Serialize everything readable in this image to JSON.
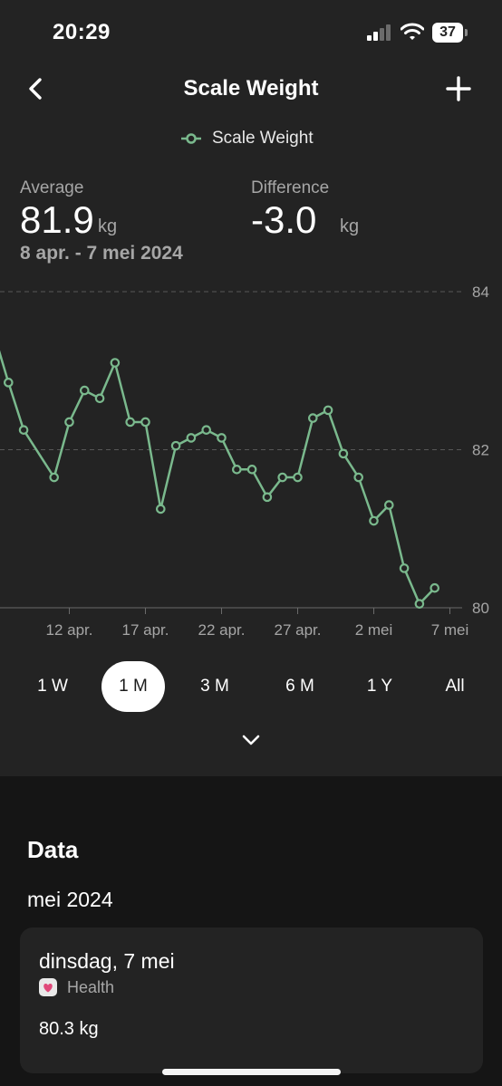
{
  "status_bar": {
    "time": "20:29",
    "battery": "37",
    "icons": [
      "signal-icon",
      "wifi-icon",
      "battery-icon"
    ]
  },
  "nav": {
    "title": "Scale Weight",
    "back_icon": "chevron-left-icon",
    "add_icon": "plus-icon"
  },
  "legend": {
    "label": "Scale Weight"
  },
  "stats": {
    "average_label": "Average",
    "average_value": "81.9",
    "average_unit": "kg",
    "difference_label": "Difference",
    "difference_value": "-3.0",
    "difference_unit": "kg",
    "range": "8 apr. - 7 mei 2024"
  },
  "chart_data": {
    "type": "line",
    "x": [
      "2024-04-07",
      "2024-04-08",
      "2024-04-09",
      "2024-04-11",
      "2024-04-12",
      "2024-04-13",
      "2024-04-14",
      "2024-04-15",
      "2024-04-16",
      "2024-04-17",
      "2024-04-18",
      "2024-04-19",
      "2024-04-20",
      "2024-04-21",
      "2024-04-22",
      "2024-04-23",
      "2024-04-24",
      "2024-04-25",
      "2024-04-26",
      "2024-04-27",
      "2024-04-28",
      "2024-04-29",
      "2024-04-30",
      "2024-05-01",
      "2024-05-02",
      "2024-05-03",
      "2024-05-04",
      "2024-05-05",
      "2024-05-06",
      "2024-05-07"
    ],
    "y": [
      83.5,
      82.85,
      82.25,
      81.65,
      82.35,
      82.75,
      82.65,
      83.1,
      82.35,
      82.35,
      81.25,
      82.05,
      82.15,
      82.25,
      82.15,
      81.75,
      81.75,
      81.4,
      81.65,
      81.65,
      82.4,
      82.5,
      81.95,
      81.65,
      81.1,
      81.3,
      80.5,
      80.05,
      80.25
    ],
    "x_ticks": [
      "12 apr.",
      "17 apr.",
      "22 apr.",
      "27 apr.",
      "2 mei",
      "7 mei"
    ],
    "y_ticks": [
      "84",
      "82",
      "80"
    ],
    "ylim": [
      80,
      84
    ],
    "grid": "dashed horizontal at y ticks",
    "line_color": "#7ab98d",
    "marker": "hollow circle"
  },
  "range_tabs": [
    {
      "label": "1 W",
      "active": false
    },
    {
      "label": "1 M",
      "active": true
    },
    {
      "label": "3 M",
      "active": false
    },
    {
      "label": "6 M",
      "active": false
    },
    {
      "label": "1 Y",
      "active": false
    },
    {
      "label": "All",
      "active": false
    }
  ],
  "expand_icon": "chevron-down-icon",
  "data_section": {
    "heading": "Data",
    "month": "mei 2024",
    "entries": [
      {
        "date": "dinsdag, 7 mei",
        "source": "Health",
        "source_icon": "heart-icon",
        "value": "80.3 kg"
      }
    ]
  },
  "colors": {
    "background": "#232323",
    "lower_background": "#151515",
    "accent_green": "#7ab98d",
    "muted_text": "#a6a6a6"
  }
}
